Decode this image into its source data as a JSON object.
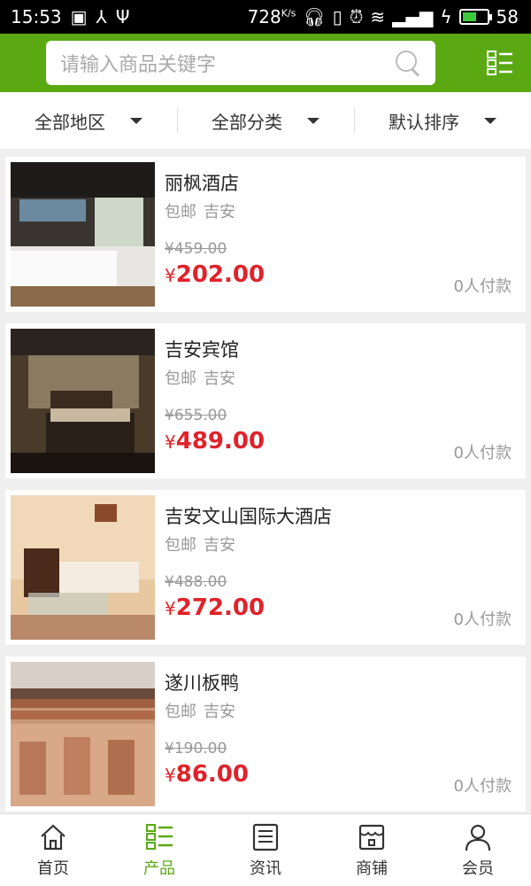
{
  "status": {
    "time": "15:53",
    "speed_value": "728",
    "speed_unit": "K/s",
    "battery": "58"
  },
  "search": {
    "placeholder": "请输入商品关键字"
  },
  "filters": [
    {
      "label": "全部地区"
    },
    {
      "label": "全部分类"
    },
    {
      "label": "默认排序"
    }
  ],
  "products": [
    {
      "name": "丽枫酒店",
      "tags": [
        "包邮",
        "吉安"
      ],
      "old_price": "¥459.00",
      "currency": "¥",
      "price": "202.00",
      "paid": "0人付款"
    },
    {
      "name": "吉安宾馆",
      "tags": [
        "包邮",
        "吉安"
      ],
      "old_price": "¥655.00",
      "currency": "¥",
      "price": "489.00",
      "paid": "0人付款"
    },
    {
      "name": "吉安文山国际大酒店",
      "tags": [
        "包邮",
        "吉安"
      ],
      "old_price": "¥488.00",
      "currency": "¥",
      "price": "272.00",
      "paid": "0人付款"
    },
    {
      "name": "遂川板鸭",
      "tags": [
        "包邮",
        "吉安"
      ],
      "old_price": "¥190.00",
      "currency": "¥",
      "price": "86.00",
      "paid": "0人付款"
    }
  ],
  "tabs": [
    {
      "label": "首页",
      "icon": "home-icon"
    },
    {
      "label": "产品",
      "icon": "list-icon"
    },
    {
      "label": "资讯",
      "icon": "news-icon"
    },
    {
      "label": "商铺",
      "icon": "store-icon"
    },
    {
      "label": "会员",
      "icon": "user-icon"
    }
  ],
  "colors": {
    "brand_green": "#5aa912",
    "price_red": "#e0222a"
  }
}
